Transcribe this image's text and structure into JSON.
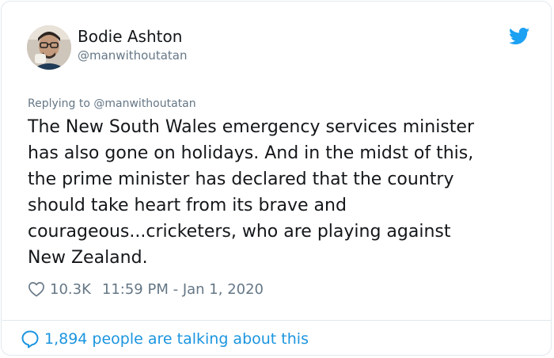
{
  "author": {
    "name": "Bodie Ashton",
    "handle": "@manwithoutatan"
  },
  "reply": {
    "prefix": "Replying to ",
    "to": "@manwithoutatan"
  },
  "tweet": {
    "text": "The New South Wales emergency services minister\nhas also gone on holidays. And in the midst of this,\nthe prime minister has declared that the country\nshould take heart from its brave and\ncourageous...cricketers, who are playing against\nNew Zealand."
  },
  "meta": {
    "likes": "10.3K",
    "time": "11:59 PM",
    "separator": " - ",
    "date": "Jan 1, 2020"
  },
  "footer": {
    "talking": "1,894 people are talking about this"
  },
  "colors": {
    "brand": "#1da1f2",
    "link": "#1b95e0",
    "muted": "#657786",
    "text": "#14171a"
  }
}
